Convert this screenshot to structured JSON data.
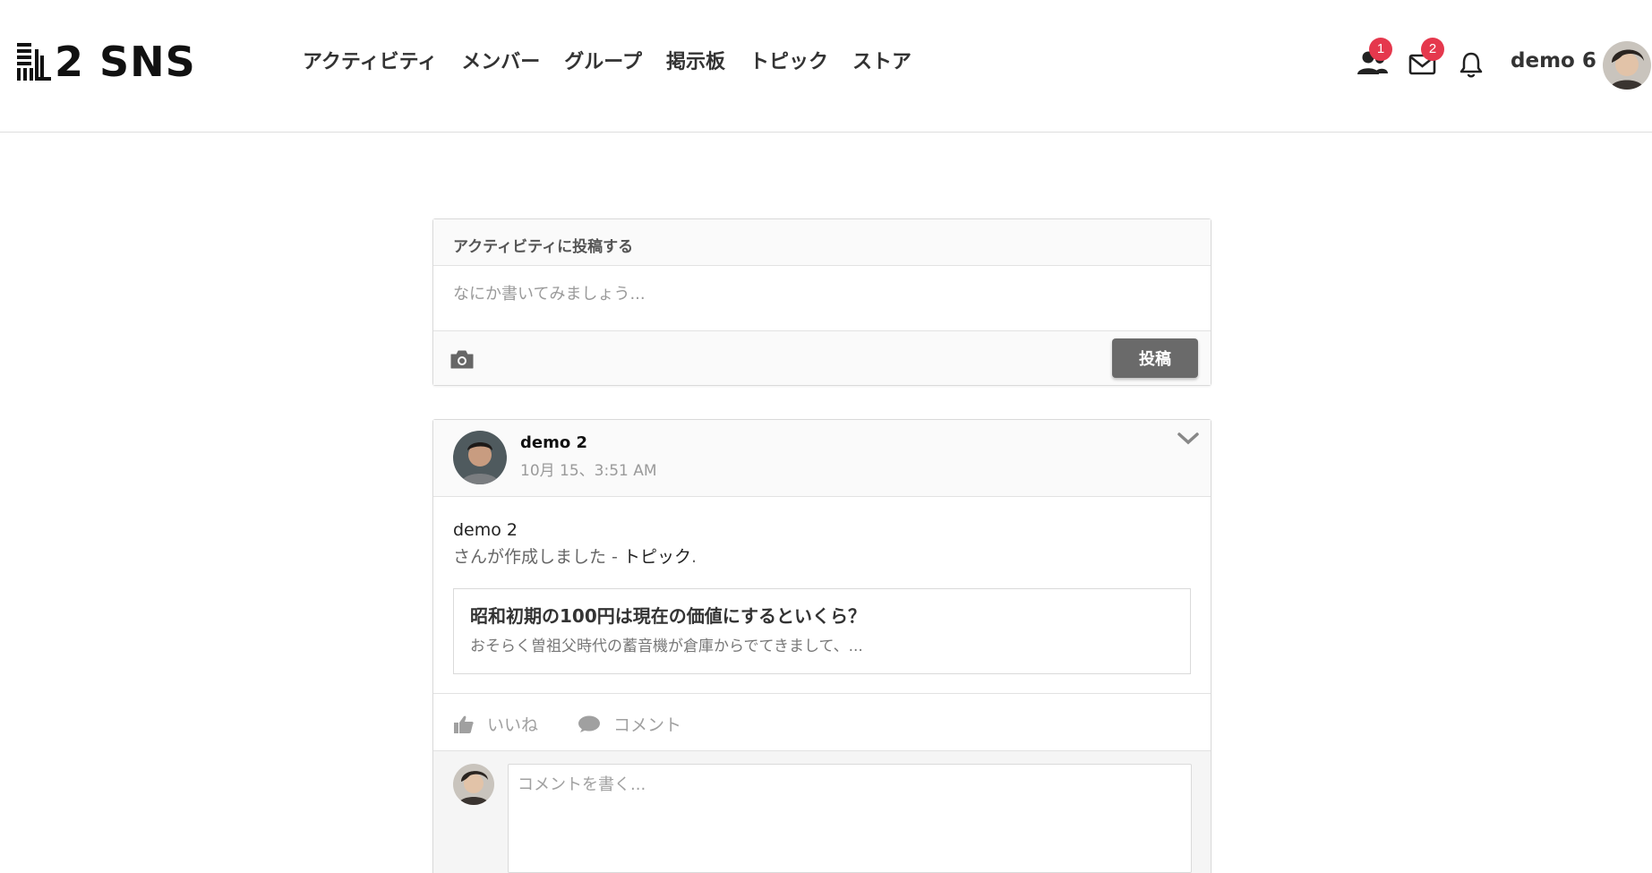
{
  "app": {
    "logo_text": "2 SNS"
  },
  "nav": {
    "items": [
      "アクティビティ",
      "メンバー",
      "グループ",
      "掲示板",
      "トピック",
      "ストア"
    ]
  },
  "header": {
    "friends_badge": "1",
    "messages_badge": "2",
    "username": "demo 6"
  },
  "composer": {
    "heading": "アクティビティに投稿する",
    "placeholder": "なにか書いてみましょう...",
    "post_label": "投稿"
  },
  "activity": {
    "author": "demo 2",
    "timestamp": "10月 15、3:51 AM",
    "body_author": "demo 2",
    "body_text": "さんが作成しました - ",
    "body_link": "トピック",
    "body_suffix": ".",
    "topic": {
      "title": "昭和初期の100円は現在の価値にするといくら？",
      "excerpt": "おそらく曽祖父時代の蓄音機が倉庫からでてきまして、..."
    },
    "like_label": "いいね",
    "comment_label": "コメント",
    "comment_placeholder": "コメントを書く..."
  },
  "colors": {
    "badge": "#e5384d",
    "button": "#6a6a6a"
  }
}
